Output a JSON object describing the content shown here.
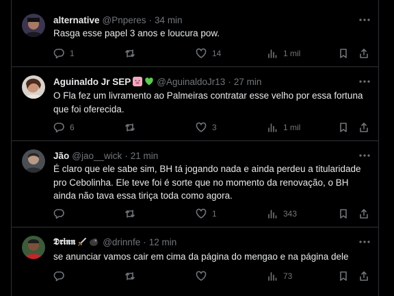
{
  "tweets": [
    {
      "name": "alternative",
      "handle": "@Pnperes",
      "time": "34 min",
      "text": "Rasga esse papel 3 anos e loucura pow.",
      "replies": "1",
      "retweets": "",
      "likes": "14",
      "views": "1 mil"
    },
    {
      "name": "Aguinaldo Jr SEP",
      "badges": [
        "pig-emoji",
        "green-heart-emoji"
      ],
      "handle": "@AguinaldoJr13",
      "time": "27 min",
      "text": "O Fla fez um livramento ao Palmeiras contratar esse velho por essa fortuna que foi oferecida.",
      "replies": "6",
      "retweets": "",
      "likes": "3",
      "views": "1 mil"
    },
    {
      "name": "Jão",
      "handle": "@jao__wick",
      "time": "21 min",
      "text": "É claro que ele sabe sim, BH tá jogando nada e ainda perdeu a titularidade pro Cebolinha. Ele teve foi é sorte que no momento da renovação, o BH ainda não tava essa tiriça toda como agora.",
      "replies": "",
      "retweets": "",
      "likes": "1",
      "views": "343"
    },
    {
      "name": "𝕯𝖗𝖎𝖓𝖓",
      "badges": [
        "dagger-emoji",
        "gorilla-emoji"
      ],
      "handle": "@drinnfe",
      "time": "12 min",
      "text": "se anunciar vamos cair em cima da página do mengao e na página dele",
      "replies": "",
      "retweets": "",
      "likes": "",
      "views": "73"
    }
  ],
  "colors": {
    "background": "#000000",
    "text": "#e7e9ea",
    "secondary": "#71767b",
    "divider": "#2f3336"
  },
  "icons": [
    "more-icon",
    "reply-icon",
    "retweet-icon",
    "like-icon",
    "views-icon",
    "bookmark-icon",
    "share-icon"
  ]
}
